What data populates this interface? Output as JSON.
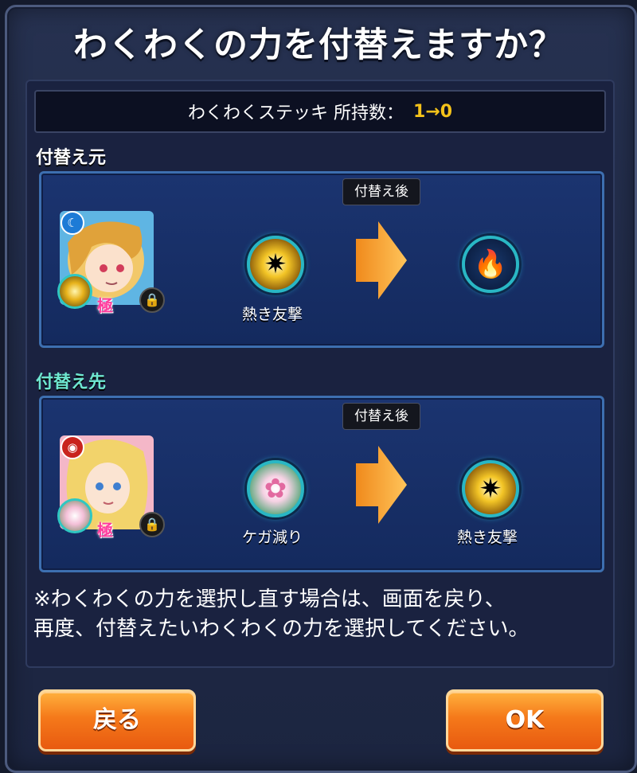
{
  "dialog": {
    "title": "わくわくの力を付替えますか？",
    "stick_label": "わくわくステッキ 所持数：",
    "stick_value": "1→0",
    "source_label": "付替え元",
    "target_label": "付替え先",
    "footnote_line1": "※わくわくの力を選択し直す場合は、画面を戻り、",
    "footnote_line2": "再度、付替えたいわくわくの力を選択してください。",
    "back_button": "戻る",
    "ok_button": "OK"
  },
  "source_card": {
    "after_tag": "付替え後",
    "current_power": "熱き友撃",
    "new_power": "",
    "kiwami": "極",
    "element": "water"
  },
  "target_card": {
    "after_tag": "付替え後",
    "current_power": "ケガ減り",
    "new_power": "熱き友撃",
    "kiwami": "極",
    "element": "fire"
  },
  "colors": {
    "stick_value": "#f4c21a",
    "source_label": "#ffffff",
    "target_label": "#6ee6d0",
    "button": "#f5791a"
  },
  "icons": {
    "source_current": "burst-orb-icon",
    "source_new": "empty-flame-slot-icon",
    "target_current": "lotus-orb-icon",
    "target_new": "burst-orb-icon"
  }
}
